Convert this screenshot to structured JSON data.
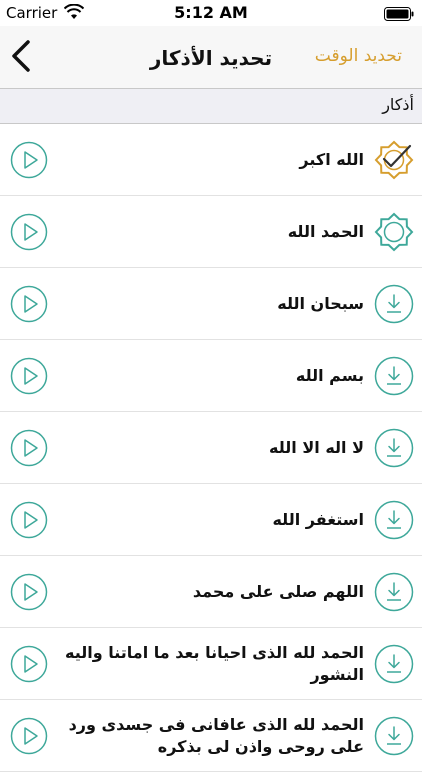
{
  "status_bar": {
    "carrier": "Carrier",
    "time": "5:12 AM"
  },
  "nav": {
    "title": "تحديد الأذكار",
    "right_action": "تحديد الوقت",
    "back_icon": "chevron-left-icon"
  },
  "section": {
    "label": "أذكار"
  },
  "items": [
    {
      "text": "الله اكبر",
      "state": "selected"
    },
    {
      "text": "الحمد الله",
      "state": "downloaded"
    },
    {
      "text": "سبحان الله",
      "state": "download"
    },
    {
      "text": "بسم الله",
      "state": "download"
    },
    {
      "text": "لا اله الا الله",
      "state": "download"
    },
    {
      "text": "استغفر الله",
      "state": "download"
    },
    {
      "text": "اللهم صلى على محمد",
      "state": "download"
    },
    {
      "text": "الحمد لله الذى احيانا بعد ما اماتنا واليه النشور",
      "state": "download"
    },
    {
      "text": "الحمد لله الذى عافانى فى جسدى ورد على روحى واذن لى بذكره",
      "state": "download"
    }
  ],
  "colors": {
    "accent_teal": "#3ea89a",
    "orange": "#d69e2e",
    "header_bg": "#efeff4"
  }
}
